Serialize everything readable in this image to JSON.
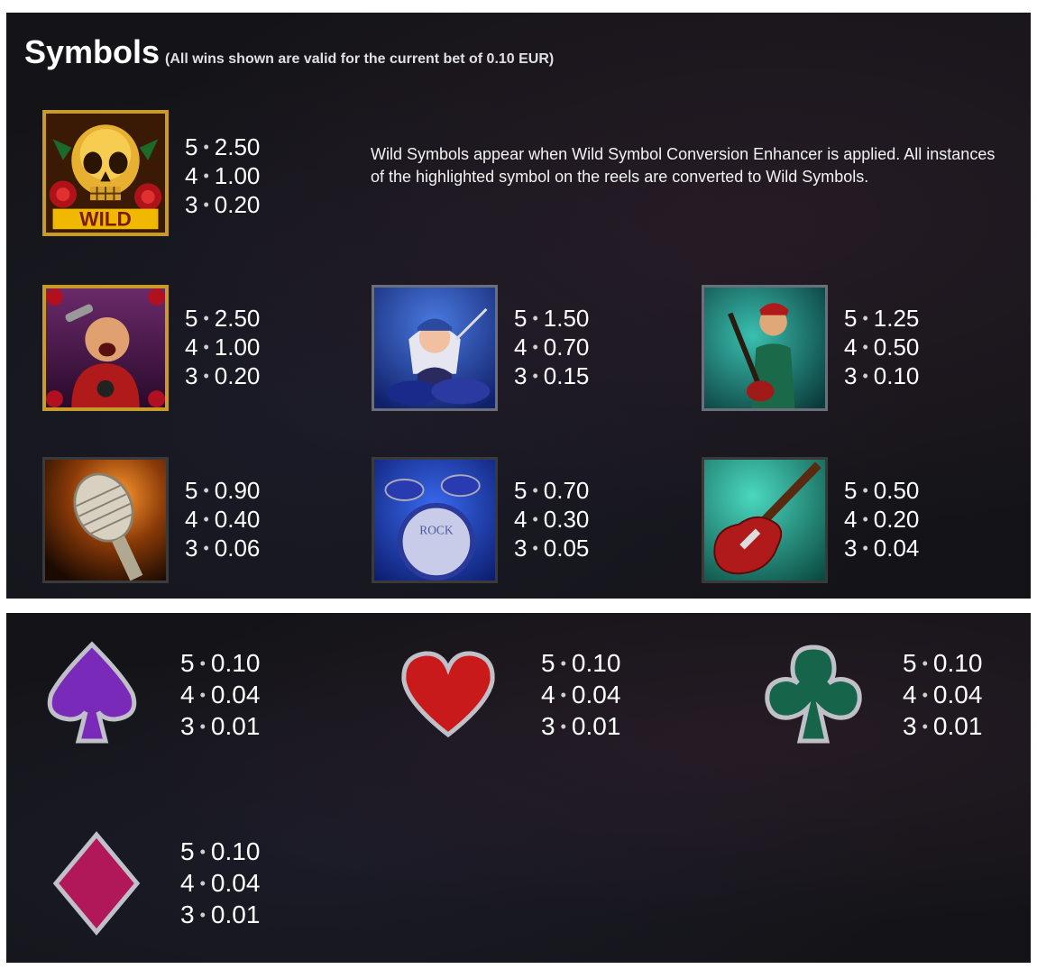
{
  "header": {
    "title": "Symbols",
    "subtitle": "(All wins shown are valid for the current bet of 0.10 EUR)"
  },
  "wild": {
    "icon": "wild-skull-icon",
    "description": "Wild Symbols appear when Wild Symbol Conversion Enhancer is applied. All instances of the highlighted symbol on the reels are converted to Wild Symbols.",
    "payouts": [
      {
        "count": "5",
        "amount": "2.50"
      },
      {
        "count": "4",
        "amount": "1.00"
      },
      {
        "count": "3",
        "amount": "0.20"
      }
    ]
  },
  "symbols": [
    {
      "icon": "singer-icon",
      "payouts": [
        {
          "count": "5",
          "amount": "2.50"
        },
        {
          "count": "4",
          "amount": "1.00"
        },
        {
          "count": "3",
          "amount": "0.20"
        }
      ]
    },
    {
      "icon": "drummer-girl-icon",
      "payouts": [
        {
          "count": "5",
          "amount": "1.50"
        },
        {
          "count": "4",
          "amount": "0.70"
        },
        {
          "count": "3",
          "amount": "0.15"
        }
      ]
    },
    {
      "icon": "guitarist-icon",
      "payouts": [
        {
          "count": "5",
          "amount": "1.25"
        },
        {
          "count": "4",
          "amount": "0.50"
        },
        {
          "count": "3",
          "amount": "0.10"
        }
      ]
    },
    {
      "icon": "microphone-icon",
      "payouts": [
        {
          "count": "5",
          "amount": "0.90"
        },
        {
          "count": "4",
          "amount": "0.40"
        },
        {
          "count": "3",
          "amount": "0.06"
        }
      ]
    },
    {
      "icon": "drum-kit-icon",
      "drum_label": "ROCK",
      "payouts": [
        {
          "count": "5",
          "amount": "0.70"
        },
        {
          "count": "4",
          "amount": "0.30"
        },
        {
          "count": "3",
          "amount": "0.05"
        }
      ]
    },
    {
      "icon": "electric-guitar-icon",
      "payouts": [
        {
          "count": "5",
          "amount": "0.50"
        },
        {
          "count": "4",
          "amount": "0.20"
        },
        {
          "count": "3",
          "amount": "0.04"
        }
      ]
    }
  ],
  "card_suits": [
    {
      "icon": "spade-icon",
      "color": "#7a2ab8",
      "payouts": [
        {
          "count": "5",
          "amount": "0.10"
        },
        {
          "count": "4",
          "amount": "0.04"
        },
        {
          "count": "3",
          "amount": "0.01"
        }
      ]
    },
    {
      "icon": "heart-icon",
      "color": "#c81a1a",
      "payouts": [
        {
          "count": "5",
          "amount": "0.10"
        },
        {
          "count": "4",
          "amount": "0.04"
        },
        {
          "count": "3",
          "amount": "0.01"
        }
      ]
    },
    {
      "icon": "club-icon",
      "color": "#16654a",
      "payouts": [
        {
          "count": "5",
          "amount": "0.10"
        },
        {
          "count": "4",
          "amount": "0.04"
        },
        {
          "count": "3",
          "amount": "0.01"
        }
      ]
    },
    {
      "icon": "diamond-icon",
      "color": "#b0185a",
      "payouts": [
        {
          "count": "5",
          "amount": "0.10"
        },
        {
          "count": "4",
          "amount": "0.04"
        },
        {
          "count": "3",
          "amount": "0.01"
        }
      ]
    }
  ],
  "separator": "•"
}
